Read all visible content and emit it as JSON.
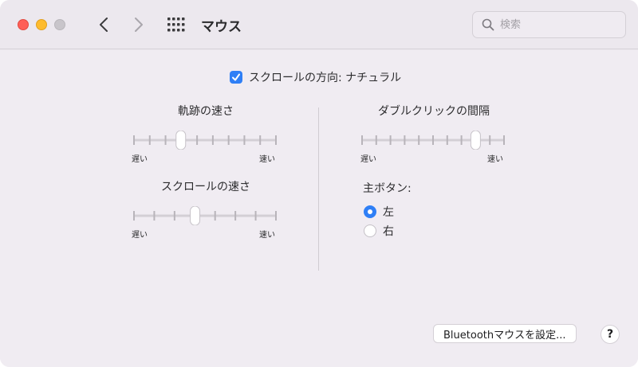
{
  "toolbar": {
    "title": "マウス",
    "search_placeholder": "検索",
    "back_icon": "chevron-left-icon",
    "forward_icon": "chevron-right-icon",
    "grid_icon": "grid-icon"
  },
  "scroll_direction": {
    "label": "スクロールの方向: ナチュラル",
    "checked": true
  },
  "tracking_speed": {
    "title": "軌跡の速さ",
    "min_label": "遅い",
    "max_label": "速い",
    "ticks": 10,
    "value": 0.33
  },
  "scroll_speed": {
    "title": "スクロールの速さ",
    "min_label": "遅い",
    "max_label": "速い",
    "ticks": 8,
    "value": 0.43
  },
  "double_click_speed": {
    "title": "ダブルクリックの間隔",
    "min_label": "遅い",
    "max_label": "速い",
    "ticks": 11,
    "value": 0.8
  },
  "primary_button": {
    "title": "主ボタン:",
    "options": [
      {
        "label": "左",
        "checked": true
      },
      {
        "label": "右",
        "checked": false
      }
    ]
  },
  "bluetooth_button": "Bluetoothマウスを設定...",
  "help_button": "?",
  "colors": {
    "accent": "#2f7ff6",
    "close": "#fe5f57",
    "minimize": "#febc2e",
    "zoom_disabled": "#c8c5ca"
  }
}
